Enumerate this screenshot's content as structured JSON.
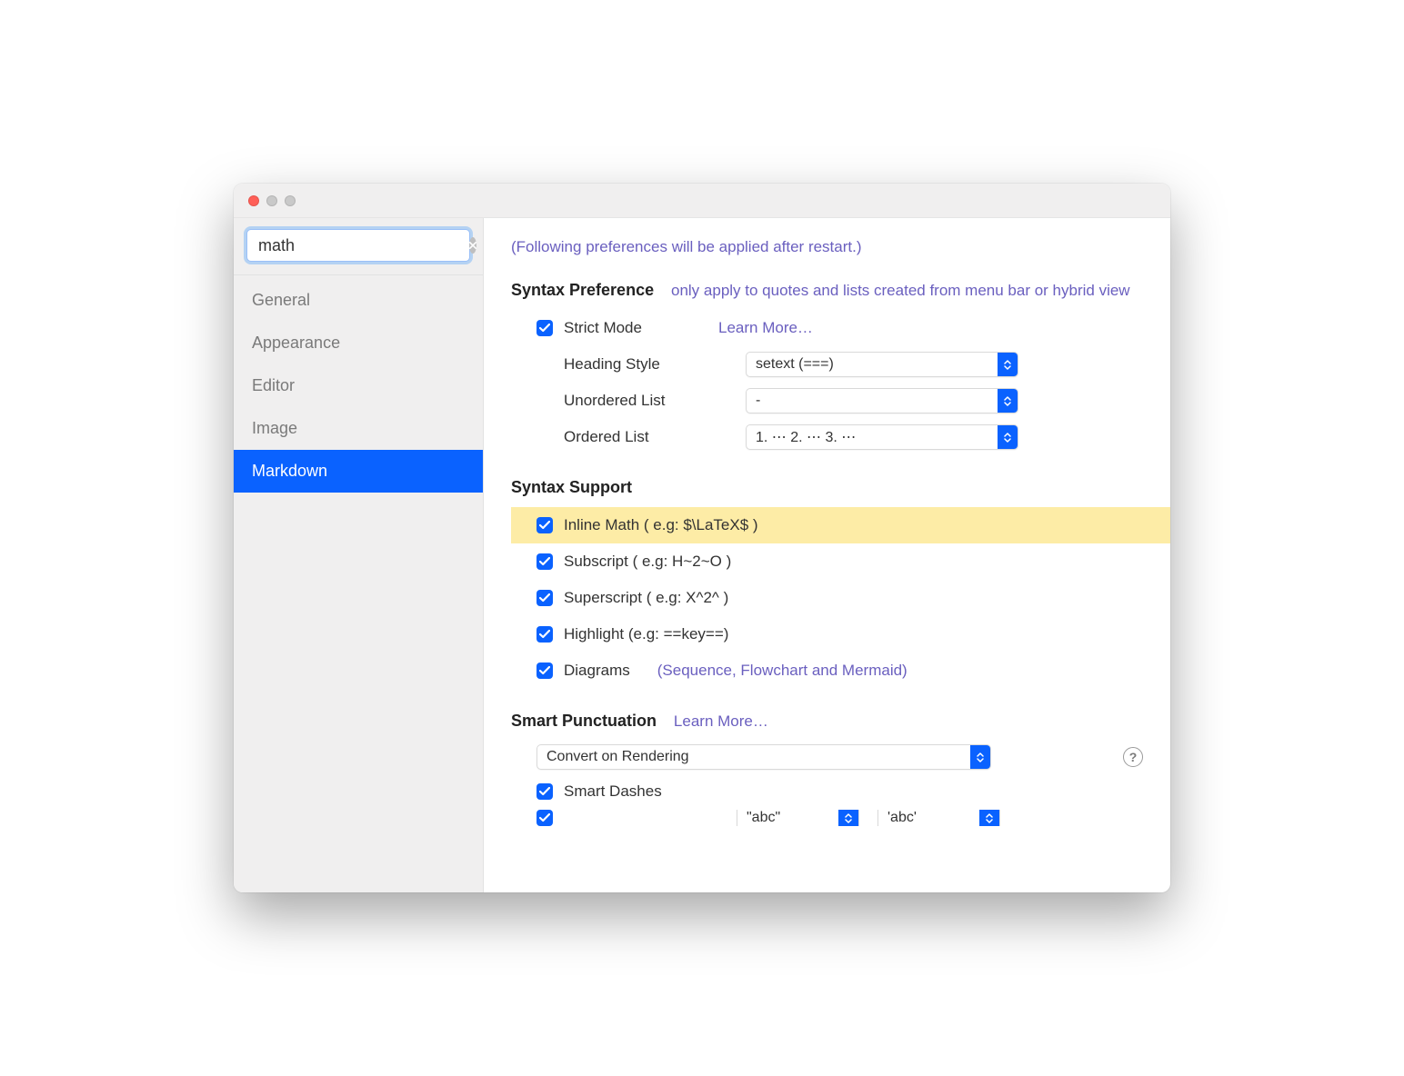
{
  "search": {
    "value": "math"
  },
  "sidebar": {
    "items": [
      {
        "label": "General"
      },
      {
        "label": "Appearance"
      },
      {
        "label": "Editor"
      },
      {
        "label": "Image"
      },
      {
        "label": "Markdown"
      }
    ],
    "selected_index": 4
  },
  "content": {
    "restart_note": "(Following preferences will be applied after restart.)",
    "syntax_pref": {
      "title": "Syntax Preference",
      "subtitle": "only apply to quotes and lists created from menu bar or hybrid view",
      "strict_mode_label": "Strict Mode",
      "strict_mode_checked": true,
      "learn_more": "Learn More…",
      "heading_style_label": "Heading Style",
      "heading_style_value": "setext (===)",
      "unordered_label": "Unordered List",
      "unordered_value": "-",
      "ordered_label": "Ordered List",
      "ordered_value": "1. ⋯ 2. ⋯ 3. ⋯"
    },
    "syntax_support": {
      "title": "Syntax Support",
      "items": [
        {
          "label": "Inline Math  ( e.g: $\\LaTeX$ )",
          "checked": true,
          "highlighted": true
        },
        {
          "label": "Subscript  ( e.g: H~2~O )",
          "checked": true
        },
        {
          "label": "Superscript  ( e.g: X^2^ )",
          "checked": true
        },
        {
          "label": "Highlight  (e.g: ==key==)",
          "checked": true
        },
        {
          "label": "Diagrams",
          "checked": true,
          "hint": "(Sequence, Flowchart and Mermaid)"
        }
      ]
    },
    "smart_punctuation": {
      "title": "Smart Punctuation",
      "learn_more": "Learn More…",
      "convert_value": "Convert on Rendering",
      "smart_dashes_label": "Smart Dashes",
      "smart_dashes_checked": true,
      "partial": {
        "quote1": "\"abc\"",
        "quote2": "'abc'"
      }
    }
  }
}
